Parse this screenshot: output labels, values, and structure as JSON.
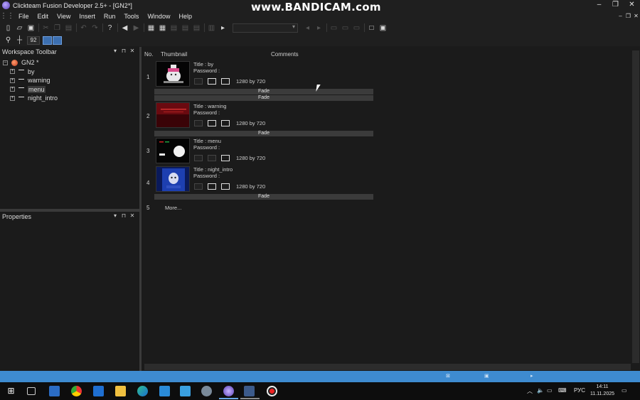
{
  "window": {
    "title": "Clickteam Fusion Developer 2.5+ - [GN2*]",
    "watermark": "www.BANDICAM.com",
    "controls": [
      "–",
      "❐",
      "✕"
    ]
  },
  "menubar": {
    "items": [
      "File",
      "Edit",
      "View",
      "Insert",
      "Run",
      "Tools",
      "Window",
      "Help"
    ]
  },
  "toolbar": {
    "zoom_value": "92"
  },
  "workspace": {
    "title": "Workspace Toolbar",
    "root": "GN2 *",
    "frames": [
      "by",
      "warning",
      "menu",
      "night_intro"
    ],
    "selected": "menu"
  },
  "properties": {
    "title": "Properties"
  },
  "storyboard": {
    "headers": {
      "no": "No.",
      "thumbnail": "Thumbnail",
      "comments": "Comments"
    },
    "frames": [
      {
        "no": "1",
        "title": "Title : by",
        "password": "Password :",
        "res_w": "1280",
        "by": "by",
        "res_h": "720"
      },
      {
        "no": "2",
        "title": "Title : warning",
        "password": "Password :",
        "res_w": "1280",
        "by": "by",
        "res_h": "720"
      },
      {
        "no": "3",
        "title": "Title : menu",
        "password": "Password :",
        "res_w": "1280",
        "by": "by",
        "res_h": "720"
      },
      {
        "no": "4",
        "title": "Title : night_intro",
        "password": "Password :",
        "res_w": "1280",
        "by": "by",
        "res_h": "720"
      }
    ],
    "transitions": [
      "Fade",
      "Fade",
      "Fade",
      "Fade"
    ],
    "more": {
      "no": "5",
      "label": "More..."
    }
  },
  "taskbar": {
    "lang": "РУС",
    "time": "14:11",
    "date": "11.11.2025"
  },
  "colors": {
    "statusbar": "#3e8bd0",
    "background": "#1b1b1b"
  }
}
